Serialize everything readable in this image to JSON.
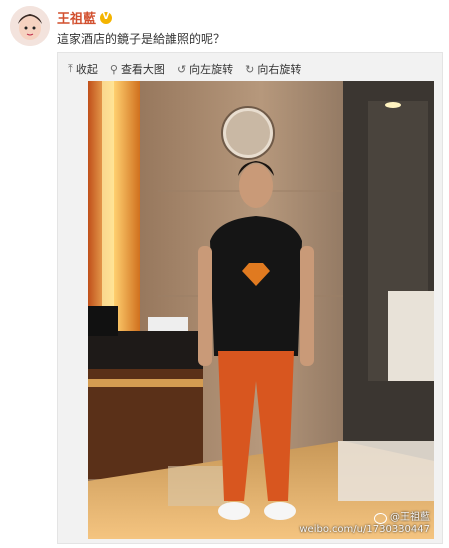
{
  "post": {
    "username": "王祖藍",
    "verified_badge": "V",
    "text": "這家酒店的鏡子是給誰照的呢？"
  },
  "toolbar": {
    "collapse": {
      "label": "收起",
      "icon": "arrow-up-icon"
    },
    "view_large": {
      "label": "查看大图",
      "icon": "magnifier-icon"
    },
    "rotate_left": {
      "label": "向左旋转",
      "icon": "rotate-left-icon"
    },
    "rotate_right": {
      "label": "向右旋转",
      "icon": "rotate-right-icon"
    }
  },
  "watermark": {
    "name": "@王祖藍",
    "url": "weibo.com/u/1730330447"
  },
  "colors": {
    "username": "#d2502f",
    "badge": "#f4b400"
  }
}
